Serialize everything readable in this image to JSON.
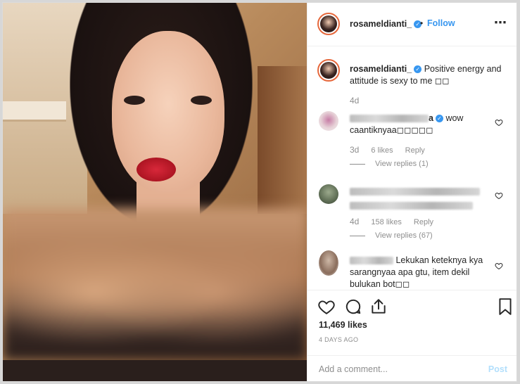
{
  "header": {
    "username": "rosameldianti_",
    "separator": "•",
    "follow_label": "Follow",
    "more_icon": "⋯"
  },
  "caption": {
    "username": "rosameldianti_",
    "text": "Positive energy and attitude is sexy to me ◻◻",
    "time": "4d"
  },
  "comments": [
    {
      "name_suffix": "a",
      "text": "wow caantiknyaa◻◻◻◻◻",
      "time": "3d",
      "likes": "6 likes",
      "reply": "Reply",
      "view_replies": "View replies (1)"
    },
    {
      "time": "4d",
      "likes": "158 likes",
      "reply": "Reply",
      "view_replies": "View replies (67)"
    },
    {
      "text": "Lekukan keteknya kya sarangnyaa apa gtu, item dekil bulukan bot◻◻"
    }
  ],
  "actions": {
    "likes": "11,469 likes",
    "posted_ago": "4 DAYS AGO",
    "comment_placeholder": "Add a comment...",
    "post_label": "Post"
  },
  "colors": {
    "accent": "#3897f0",
    "post_disabled": "#b2dffc",
    "muted": "#8e8e8e"
  },
  "icons": [
    "heart-icon",
    "comment-icon",
    "share-icon",
    "bookmark-icon",
    "more-icon",
    "verified-icon"
  ]
}
